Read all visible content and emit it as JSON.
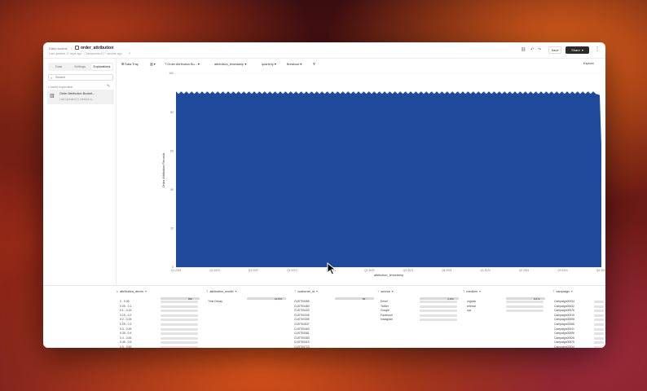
{
  "header": {
    "breadcrumb": "Data models",
    "breadcrumb_sep": "/",
    "model_name": "order_attribution",
    "updated": "Last updated 17 days ago · Checkpointed 17 minutes ago",
    "save_label": "Save",
    "share_label": "Share"
  },
  "sidebar": {
    "tabs": [
      "Data",
      "Settings",
      "Explorations"
    ],
    "search_placeholder": "Search",
    "saved_count": "1 saved exploration",
    "saved_item": {
      "title": "Order Attribution Bucket...",
      "subtitle": "Last Updated 21 minutes a..."
    }
  },
  "toolbar": {
    "type_label": "Data Tray",
    "filter_label": "T Order Attribution Bu...",
    "x_label": "attribution_timestamp",
    "granularity": "quarterly",
    "breakout": "Breakout",
    "explore_label": "Explore"
  },
  "chart_data": {
    "type": "area",
    "xlabel": "attribution_timestamp",
    "ylabel": "Order Attribution Records",
    "y_ticks": [
      "0",
      "20",
      "40",
      "60",
      "80",
      "100"
    ],
    "x_ticks": [
      "Q1 2022",
      "Q2 2022",
      "Q3 2022",
      "Q4 2022",
      "Q1 2023",
      "Q2 2023",
      "Q3 2023",
      "Q4 2023",
      "Q1 2024",
      "Q2 2024",
      "Q3 2024",
      "Q4 2024"
    ],
    "ylim": [
      0,
      100
    ],
    "level": 90,
    "color": "#1f4a9b"
  },
  "table": {
    "columns": [
      {
        "icon": "#",
        "name": "attribution_decim"
      },
      {
        "icon": "T",
        "name": "attribution_model"
      },
      {
        "icon": "T",
        "name": "customer_id"
      },
      {
        "icon": "T",
        "name": "source"
      },
      {
        "icon": "T",
        "name": "medium"
      },
      {
        "icon": "T",
        "name": "campaign"
      }
    ],
    "top_counts": [
      "899",
      "16,870",
      "86",
      "4,150",
      "8,672"
    ],
    "decim_ranges": [
      "0 - 0.05",
      "0.05 - 0.1",
      "0.1 - 0.15",
      "0.15 - 0.2",
      "0.2 - 0.25",
      "0.25 - 0.3",
      "0.3 - 0.35",
      "0.35 - 0.4",
      "0.4 - 0.45",
      "0.45 - 0.5",
      "0.5 - 0.55"
    ],
    "model_values": [
      "Time Decay"
    ],
    "customer_ids": [
      "CUST00085",
      "CUST00480",
      "CUST00430",
      "CUST00345",
      "CUST00305",
      "CUST00537",
      "CUST00463",
      "CUST00581",
      "CUST00383",
      "CUST00315",
      "CUST00723"
    ],
    "sources": [
      "Email",
      "Twitter",
      "Google",
      "Facebook",
      "Instagram"
    ],
    "mediums": [
      "organic",
      "referral",
      "cpc"
    ],
    "campaigns": [
      "Campaign00534",
      "Campaign00632",
      "Campaign00576",
      "Campaign00515",
      "Campaign00508",
      "Campaign00586",
      "Campaign00541",
      "Campaign00596",
      "Campaign00528",
      "Campaign00575",
      "Campaign00534"
    ]
  }
}
